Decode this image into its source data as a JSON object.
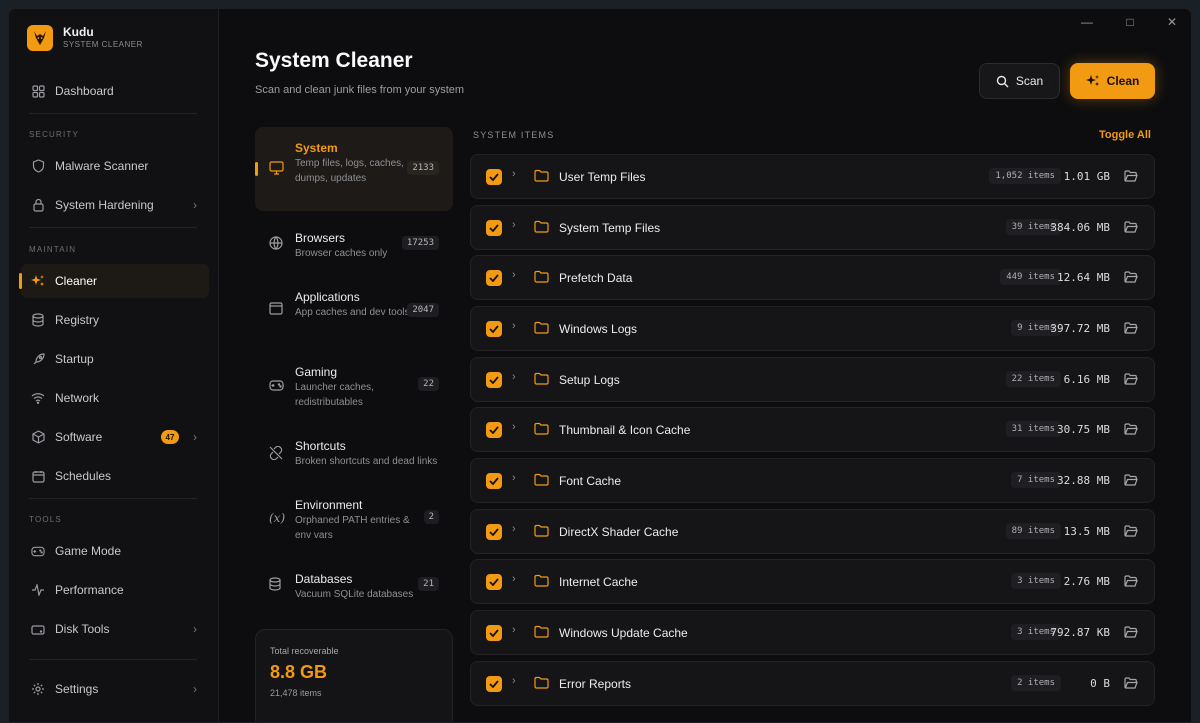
{
  "app": {
    "name": "Kudu",
    "subtitle": "SYSTEM CLEANER"
  },
  "nav": {
    "dashboard": "Dashboard",
    "security_label": "SECURITY",
    "malware": "Malware Scanner",
    "hardening": "System Hardening",
    "maintain_label": "MAINTAIN",
    "cleaner": "Cleaner",
    "registry": "Registry",
    "startup": "Startup",
    "network": "Network",
    "software": "Software",
    "software_badge": "47",
    "schedules": "Schedules",
    "tools_label": "TOOLS",
    "gamemode": "Game Mode",
    "performance": "Performance",
    "disktools": "Disk Tools",
    "settings": "Settings"
  },
  "header": {
    "title": "System Cleaner",
    "subtitle": "Scan and clean junk files from your system",
    "scan": "Scan",
    "clean": "Clean"
  },
  "categories": [
    {
      "name": "System",
      "desc": "Temp files, logs, caches, dumps, updates",
      "count": "2133"
    },
    {
      "name": "Browsers",
      "desc": "Browser caches only",
      "count": "17253"
    },
    {
      "name": "Applications",
      "desc": "App caches and dev tools",
      "count": "2047"
    },
    {
      "name": "Gaming",
      "desc": "Launcher caches, redistributables",
      "count": "22"
    },
    {
      "name": "Shortcuts",
      "desc": "Broken shortcuts and dead links",
      "count": ""
    },
    {
      "name": "Environment",
      "desc": "Orphaned PATH entries & env vars",
      "count": "2"
    },
    {
      "name": "Databases",
      "desc": "Vacuum SQLite databases",
      "count": "21"
    }
  ],
  "totals": {
    "label": "Total recoverable",
    "value": "8.8 GB",
    "items": "21,478 items"
  },
  "list": {
    "heading": "SYSTEM ITEMS",
    "toggle": "Toggle All",
    "rows": [
      {
        "name": "User Temp Files",
        "count": "1,052 items",
        "size": "1.01 GB"
      },
      {
        "name": "System Temp Files",
        "count": "39 items",
        "size": "384.06 MB"
      },
      {
        "name": "Prefetch Data",
        "count": "449 items",
        "size": "12.64 MB"
      },
      {
        "name": "Windows Logs",
        "count": "9 items",
        "size": "397.72 MB"
      },
      {
        "name": "Setup Logs",
        "count": "22 items",
        "size": "6.16 MB"
      },
      {
        "name": "Thumbnail & Icon Cache",
        "count": "31 items",
        "size": "30.75 MB"
      },
      {
        "name": "Font Cache",
        "count": "7 items",
        "size": "32.88 MB"
      },
      {
        "name": "DirectX Shader Cache",
        "count": "89 items",
        "size": "13.5 MB"
      },
      {
        "name": "Internet Cache",
        "count": "3 items",
        "size": "2.76 MB"
      },
      {
        "name": "Windows Update Cache",
        "count": "3 items",
        "size": "792.87 KB"
      },
      {
        "name": "Error Reports",
        "count": "2 items",
        "size": "0 B"
      }
    ]
  },
  "colors": {
    "accent": "#f29a12",
    "background": "#0d0d0f",
    "sidebar": "#111113"
  }
}
